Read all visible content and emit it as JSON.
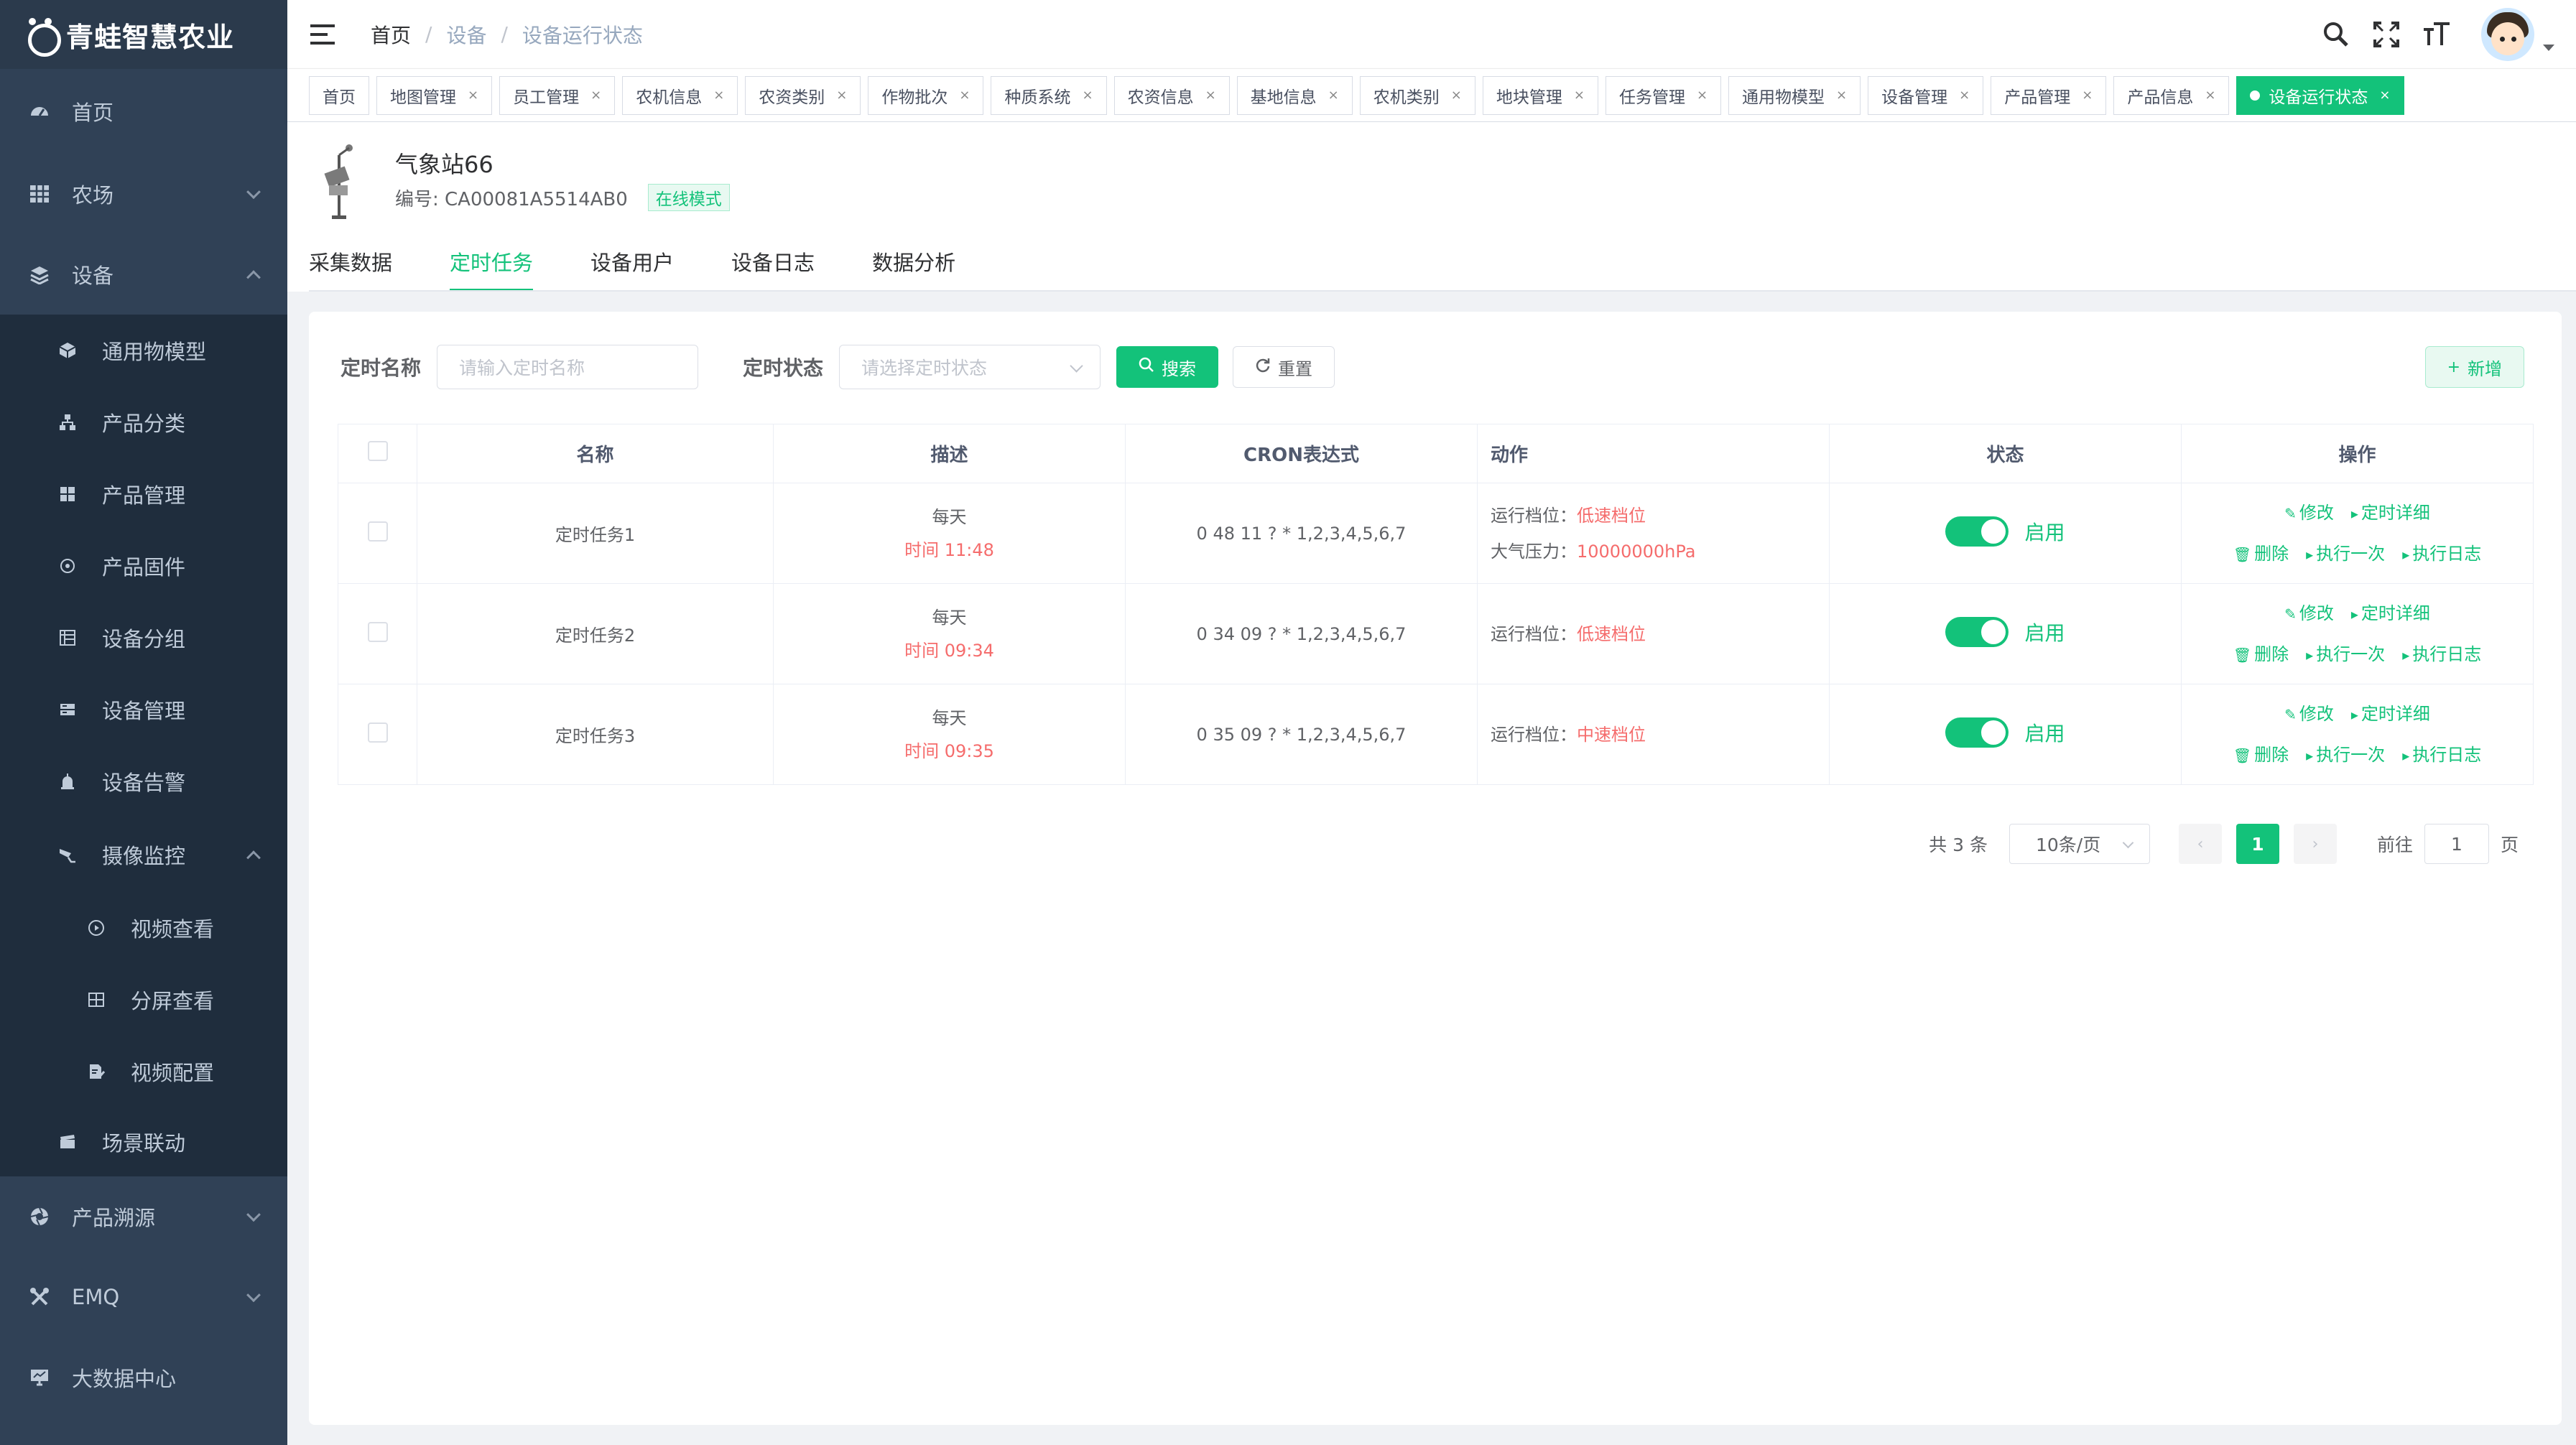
{
  "app": {
    "logo_text": "青蛙智慧农业"
  },
  "sidebar": {
    "home": "首页",
    "farm": "农场",
    "device": "设备",
    "device_children": [
      "通用物模型",
      "产品分类",
      "产品管理",
      "产品固件",
      "设备分组",
      "设备管理",
      "设备告警"
    ],
    "camera": "摄像监控",
    "camera_children": [
      "视频查看",
      "分屏查看",
      "视频配置"
    ],
    "scene": "场景联动",
    "trace": "产品溯源",
    "emq": "EMQ",
    "bigdata": "大数据中心"
  },
  "breadcrumb": {
    "home": "首页",
    "level1": "设备",
    "current": "设备运行状态",
    "sep": "/"
  },
  "tags": [
    "首页",
    "地图管理",
    "员工管理",
    "农机信息",
    "农资类别",
    "作物批次",
    "种质系统",
    "农资信息",
    "基地信息",
    "农机类别",
    "地块管理",
    "任务管理",
    "通用物模型",
    "设备管理",
    "产品管理",
    "产品信息"
  ],
  "active_tag": "设备运行状态",
  "tag_close": "×",
  "device": {
    "name": "气象站66",
    "code": "编号: CA00081A5514AB0",
    "mode_badge": "在线模式"
  },
  "tabs": [
    "采集数据",
    "定时任务",
    "设备用户",
    "设备日志",
    "数据分析"
  ],
  "filter": {
    "name_label": "定时名称",
    "name_placeholder": "请输入定时名称",
    "status_label": "定时状态",
    "status_placeholder": "请选择定时状态",
    "search_btn": "搜索",
    "reset_btn": "重置",
    "add_btn": "新增"
  },
  "table": {
    "headers": [
      "名称",
      "描述",
      "CRON表达式",
      "动作",
      "状态",
      "操作"
    ],
    "rows": [
      {
        "name": "定时任务1",
        "desc_line1": "每天",
        "desc_line2": "时间 11:48",
        "cron": "0 48 11 ? * 1,2,3,4,5,6,7",
        "act1_label": "运行档位：",
        "act1_value": "低速档位",
        "act2_label": "大气压力：",
        "act2_value": "10000000hPa",
        "status": "启用"
      },
      {
        "name": "定时任务2",
        "desc_line1": "每天",
        "desc_line2": "时间 09:34",
        "cron": "0 34 09 ? * 1,2,3,4,5,6,7",
        "act1_label": "运行档位：",
        "act1_value": "低速档位",
        "status": "启用"
      },
      {
        "name": "定时任务3",
        "desc_line1": "每天",
        "desc_line2": "时间 09:35",
        "cron": "0 35 09 ? * 1,2,3,4,5,6,7",
        "act1_label": "运行档位：",
        "act1_value": "中速档位",
        "status": "启用"
      }
    ],
    "ops": {
      "edit": "修改",
      "detail": "定时详细",
      "delete": "删除",
      "run_once": "执行一次",
      "log": "执行日志"
    }
  },
  "pagination": {
    "total": "共 3 条",
    "page_size": "10条/页",
    "current_page": "1",
    "goto_label": "前往",
    "goto_value": "1",
    "page_unit": "页"
  },
  "colors": {
    "primary": "#13c27a",
    "sidebar_bg": "#304156",
    "submenu_bg": "#1f2d3d",
    "danger": "#f56c6c"
  }
}
